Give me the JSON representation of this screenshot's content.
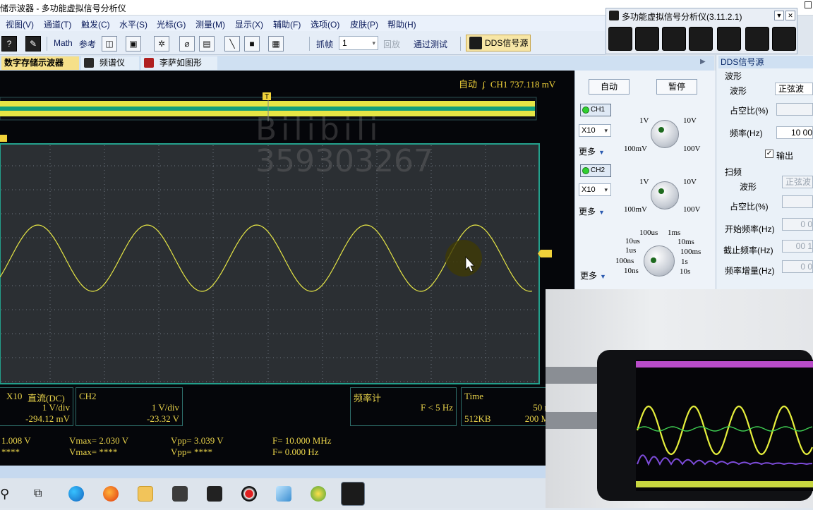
{
  "window": {
    "title": "储示波器 - 多功能虚拟信号分析仪"
  },
  "menu": [
    "视图(V)",
    "通道(T)",
    "触发(C)",
    "水平(S)",
    "光标(G)",
    "测量(M)",
    "显示(X)",
    "辅助(F)",
    "选项(O)",
    "皮肤(P)",
    "帮助(H)"
  ],
  "toolbar": {
    "help": "?",
    "math": "Math",
    "ref": "参考",
    "capture_label": "抓帧",
    "capture_value": "1",
    "playback": "回放",
    "test": "通过测试",
    "dds": "DDS信号源"
  },
  "tabs": [
    "数字存储示波器",
    "频谱仪",
    "李萨如图形"
  ],
  "scope": {
    "status_mode": "自动",
    "status_channel": "CH1",
    "status_level": "737.118 mV",
    "trigger_marker": "T",
    "watermark_line1": "Bilibili",
    "watermark_line2": "359303267",
    "colors": {
      "trace": "#e6e645",
      "grid_border": "#23a08c",
      "bg": "#2b2f33"
    }
  },
  "infoboxes": {
    "ch1": {
      "probe": "X10",
      "coupling": "直流(DC)",
      "scale": "1 V/div",
      "offset": "-294.12 mV"
    },
    "ch2": {
      "name": "CH2",
      "scale": "1 V/div",
      "offset": "-23.32 V"
    },
    "freq": {
      "title": "频率计",
      "value": "F < 5 Hz"
    },
    "time": {
      "title": "Time",
      "scale": "50 n",
      "depth": "512KB",
      "rate": "200 M"
    }
  },
  "measurements": {
    "row1": {
      "vmin": "1.008 V",
      "vmax": "Vmax= 2.030 V",
      "vpp": "Vpp= 3.039 V",
      "freq": "F= 10.000 MHz"
    },
    "row2": {
      "vmin": "****",
      "vmax": "Vmax= ****",
      "vpp": "Vpp= ****",
      "freq": "F= 0.000 Hz"
    }
  },
  "controls": {
    "auto": "自动",
    "pause": "暂停",
    "ch1": {
      "label": "CH1",
      "probe": "X10",
      "more": "更多",
      "knob": [
        "1V",
        "10V",
        "100mV",
        "100V"
      ]
    },
    "ch2": {
      "label": "CH2",
      "probe": "X10",
      "more": "更多",
      "knob": [
        "1V",
        "10V",
        "100mV",
        "100V"
      ]
    },
    "time": {
      "more": "更多",
      "knob": [
        "100us",
        "1ms",
        "10us",
        "10ms",
        "1us",
        "100ms",
        "100ns",
        "1s",
        "10ns",
        "10s"
      ]
    }
  },
  "dds": {
    "title": "DDS信号源",
    "waveform_group": "波形",
    "waveform_label": "波形",
    "waveform_value": "正弦波",
    "duty_label": "占空比(%)",
    "freq_label": "频率(Hz)",
    "freq_value": "10 00",
    "output_label": "输出",
    "output_checked": "✓",
    "sweep_group": "扫频",
    "sweep_wave_label": "波形",
    "sweep_wave_value": "正弦波",
    "sweep_duty_label": "占空比(%)",
    "start_label": "开始频率(Hz)",
    "start_value": "0 0",
    "stop_label": "截止频率(Hz)",
    "stop_value": "00 1",
    "step_label": "频率增量(Hz)",
    "step_value": "0 0"
  },
  "analyzer": {
    "title": "多功能虚拟信号分析仪(3.11.2.1)",
    "dropdown": "▼",
    "close": "✕"
  }
}
